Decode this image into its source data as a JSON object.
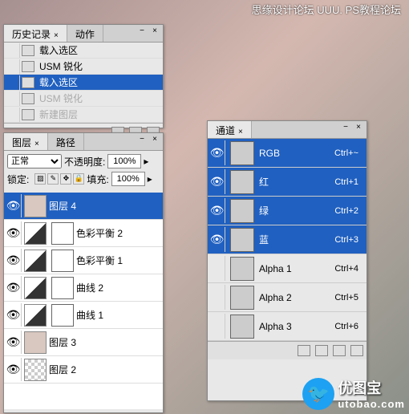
{
  "watermarks": {
    "top": "思缘设计论坛  UUU.     PS教程论坛",
    "logo_brand": "优图宝",
    "logo_url": "utobao.com"
  },
  "history": {
    "tab1": "历史记录",
    "tab2": "动作",
    "items": [
      {
        "label": "载入选区",
        "selected": false,
        "disabled": false
      },
      {
        "label": "USM 锐化",
        "selected": false,
        "disabled": false
      },
      {
        "label": "载入选区",
        "selected": true,
        "disabled": false
      },
      {
        "label": "USM 锐化",
        "selected": false,
        "disabled": true
      },
      {
        "label": "新建图层",
        "selected": false,
        "disabled": true
      }
    ]
  },
  "layers": {
    "tab1": "图层",
    "tab2": "路径",
    "blend_mode": "正常",
    "opacity_label": "不透明度:",
    "opacity_value": "100%",
    "lock_label": "锁定:",
    "fill_label": "填充:",
    "fill_value": "100%",
    "items": [
      {
        "name": "图层 4",
        "selected": true,
        "type": "image"
      },
      {
        "name": "色彩平衡 2",
        "selected": false,
        "type": "adjust"
      },
      {
        "name": "色彩平衡 1",
        "selected": false,
        "type": "adjust"
      },
      {
        "name": "曲线 2",
        "selected": false,
        "type": "adjust"
      },
      {
        "name": "曲线 1",
        "selected": false,
        "type": "adjust"
      },
      {
        "name": "图层 3",
        "selected": false,
        "type": "image"
      },
      {
        "name": "图层 2",
        "selected": false,
        "type": "checker"
      }
    ]
  },
  "channels": {
    "tab1": "通道",
    "items": [
      {
        "name": "RGB",
        "key": "Ctrl+~",
        "selected": true
      },
      {
        "name": "红",
        "key": "Ctrl+1",
        "selected": true
      },
      {
        "name": "绿",
        "key": "Ctrl+2",
        "selected": true
      },
      {
        "name": "蓝",
        "key": "Ctrl+3",
        "selected": true
      },
      {
        "name": "Alpha 1",
        "key": "Ctrl+4",
        "selected": false
      },
      {
        "name": "Alpha 2",
        "key": "Ctrl+5",
        "selected": false
      },
      {
        "name": "Alpha 3",
        "key": "Ctrl+6",
        "selected": false
      }
    ]
  }
}
